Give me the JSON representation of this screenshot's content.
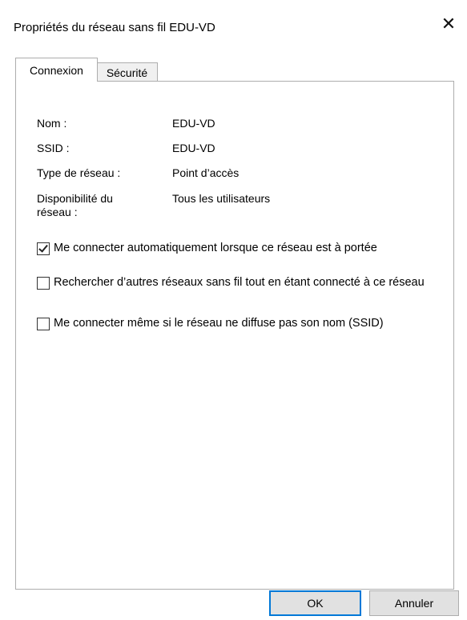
{
  "window": {
    "title": "Propriétés du réseau sans fil EDU-VD",
    "close_glyph": "✕"
  },
  "tabs": [
    {
      "label": "Connexion",
      "active": true
    },
    {
      "label": "Sécurité",
      "active": false
    }
  ],
  "properties": [
    {
      "label": "Nom :",
      "value": "EDU-VD"
    },
    {
      "label": "SSID :",
      "value": "EDU-VD"
    },
    {
      "label": "Type de réseau :",
      "value": "Point d’accès"
    },
    {
      "label": "Disponibilité du réseau :",
      "value": "Tous les utilisateurs"
    }
  ],
  "options": [
    {
      "label": "Me connecter automatiquement lorsque ce réseau est à portée",
      "checked": true
    },
    {
      "label": "Rechercher d’autres réseaux sans fil tout en étant connecté à ce réseau",
      "checked": false
    },
    {
      "label": "Me connecter même si le réseau ne diffuse pas son nom (SSID)",
      "checked": false
    }
  ],
  "buttons": {
    "ok_label": "OK",
    "cancel_label": "Annuler"
  },
  "colors": {
    "accent": "#0078d7",
    "border": "#adadad"
  }
}
